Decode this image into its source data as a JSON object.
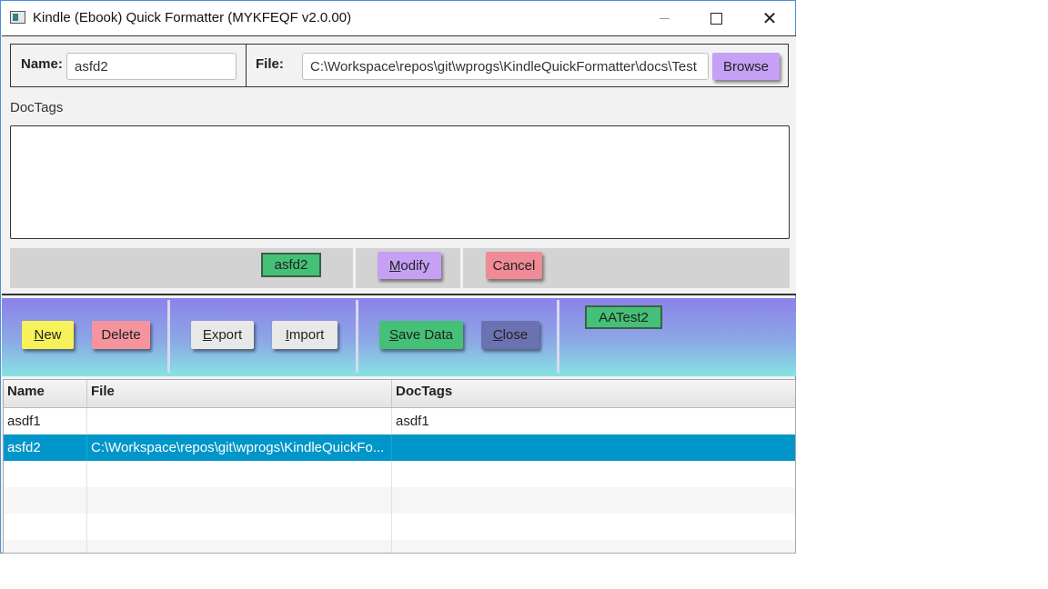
{
  "window": {
    "title": "Kindle (Ebook) Quick Formatter (MYKFEQF v2.0.00)",
    "min_symbol": "",
    "close_symbol": "✕"
  },
  "form": {
    "name_label": "Name:",
    "name_value": "asfd2",
    "file_label": "File:",
    "file_value": "C:\\Workspace\\repos\\git\\wprogs\\KindleQuickFormatter\\docs\\Test",
    "browse_label": "Browse",
    "doctags_label": "DocTags",
    "doctags_value": ""
  },
  "action_bar": {
    "current_tag": "asfd2",
    "modify_label_first": "M",
    "modify_label_rest": "odify",
    "cancel_label": "Cancel"
  },
  "toolbar": {
    "new_first": "N",
    "new_rest": "ew",
    "delete_label": "Delete",
    "export_first": "E",
    "export_rest": "xport",
    "import_first": "I",
    "import_rest": "mport",
    "save_first": "S",
    "save_rest": "ave Data",
    "close_first": "C",
    "close_rest": "lose",
    "status_tag": "AATest2"
  },
  "table": {
    "columns": [
      "Name",
      "File",
      "DocTags"
    ],
    "rows": [
      {
        "name": "asdf1",
        "file": "",
        "doctags": "asdf1"
      },
      {
        "name": "asfd2",
        "file": "C:\\Workspace\\repos\\git\\wprogs\\KindleQuickFo...",
        "doctags": ""
      }
    ],
    "selected_row": 1
  },
  "colors": {
    "browse": "#c5a0f5",
    "modify": "#c5a0f5",
    "cancel": "#f08a96",
    "tag_green": "#45c077",
    "new": "#f7f25a",
    "delete": "#f5949f",
    "export": "#e8e8e8",
    "save": "#45c077",
    "close": "#6a72b2",
    "selection": "#0096c9"
  }
}
